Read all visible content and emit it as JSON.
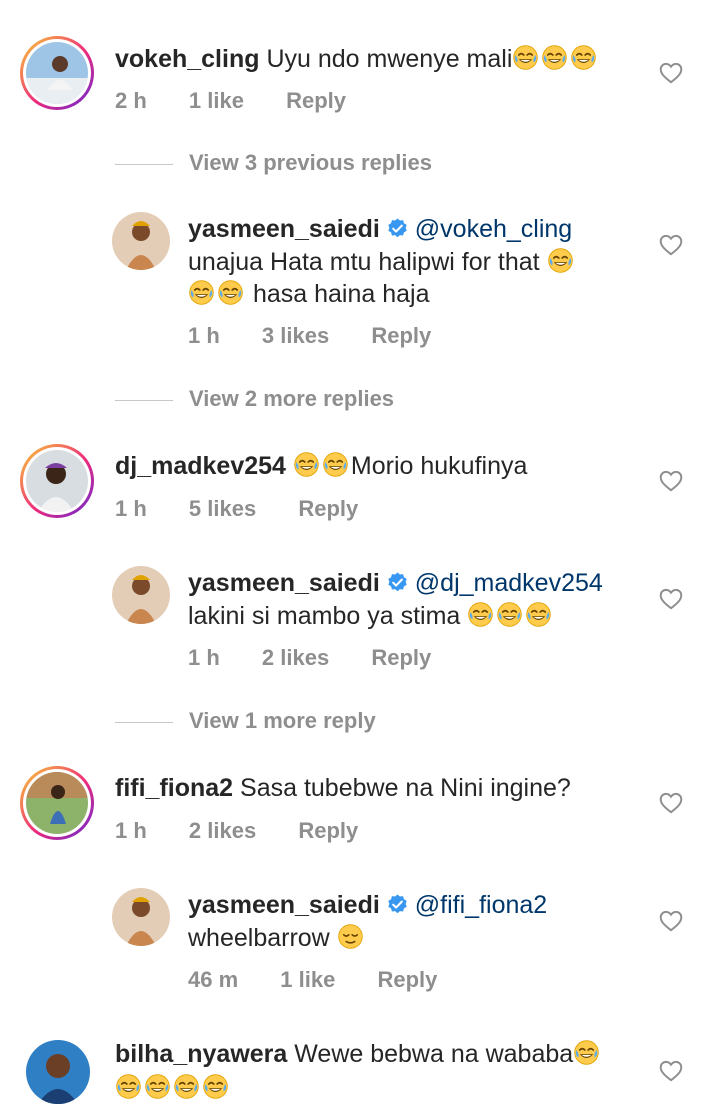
{
  "comments": [
    {
      "username": "vokeh_cling",
      "text": "Uyu ndo mwenye mali",
      "emoji_after": [
        "joy-emoji",
        "joy-emoji",
        "joy-emoji"
      ],
      "time": "2 h",
      "likes": "1 like",
      "reply_label": "Reply"
    },
    {
      "view_replies": "View 3 previous replies"
    },
    {
      "username": "yasmeen_saiedi",
      "mention": "@vokeh_cling",
      "text_line1": "unajua Hata mtu halipwi for that",
      "text_line2": "hasa haina haja",
      "time": "1 h",
      "likes": "3 likes",
      "reply_label": "Reply"
    },
    {
      "view_replies": "View 2 more replies"
    },
    {
      "username": "dj_madkev254",
      "text": "Morio hukufinya",
      "time": "1 h",
      "likes": "5 likes",
      "reply_label": "Reply"
    },
    {
      "username": "yasmeen_saiedi",
      "mention": "@dj_madkev254",
      "text": "lakini si mambo ya stima",
      "time": "1 h",
      "likes": "2 likes",
      "reply_label": "Reply"
    },
    {
      "view_replies": "View 1 more reply"
    },
    {
      "username": "fifi_fiona2",
      "text": "Sasa tubebwe na Nini ingine?",
      "time": "1 h",
      "likes": "2 likes",
      "reply_label": "Reply"
    },
    {
      "username": "yasmeen_saiedi",
      "mention": "@fifi_fiona2",
      "text": "wheelbarrow",
      "time": "46 m",
      "likes": "1 like",
      "reply_label": "Reply"
    },
    {
      "username": "bilha_nyawera",
      "text": "Wewe bebwa na wababa"
    }
  ],
  "icons": {
    "heart": "heart-outline-icon",
    "verified": "verified-badge-icon",
    "laugh": "face-with-tears-of-joy-emoji",
    "relieved": "relieved-face-emoji"
  },
  "colors": {
    "username": "#262626",
    "mention": "#00376b",
    "meta": "#8e8e8e",
    "verified": "#3897f0",
    "story_ring": "#ee2a7b"
  }
}
